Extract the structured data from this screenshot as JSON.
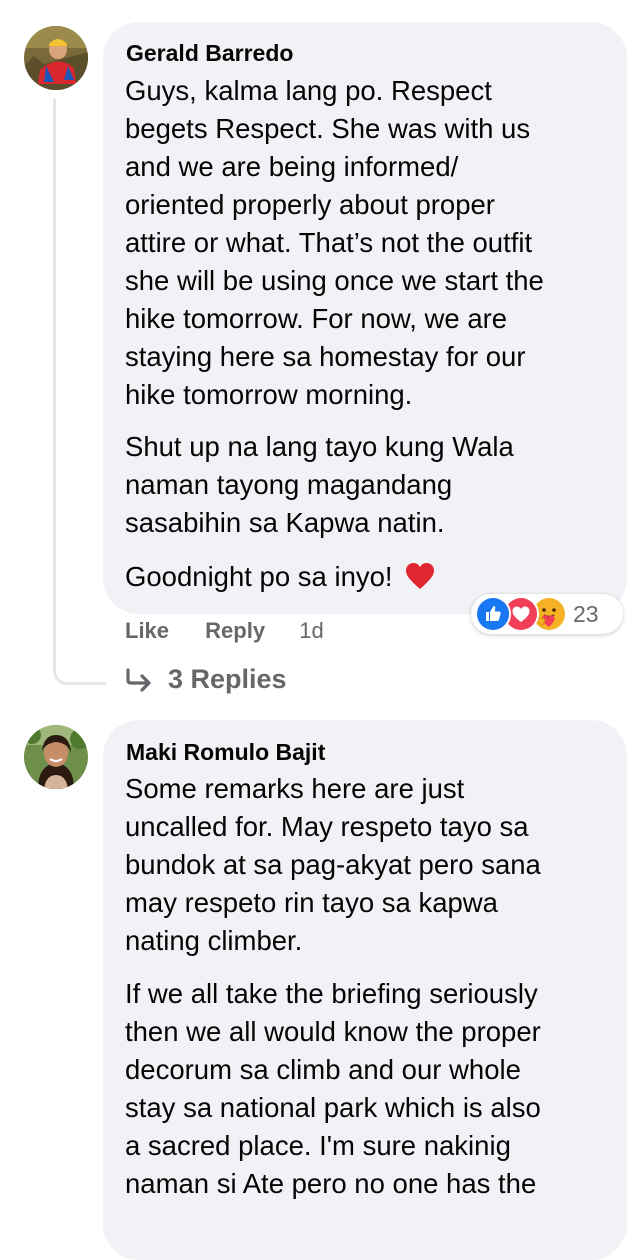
{
  "comments": [
    {
      "author": "Gerald Barredo",
      "paragraphs": [
        [
          "Guys, kalma lang po. Respect",
          "begets Respect. She was with us",
          "and we are being informed/",
          "oriented properly about proper",
          "attire or what. That’s not the outfit",
          "she will be using once we start the",
          "hike tomorrow. For now, we are",
          "staying here sa homestay for our",
          "hike tomorrow morning."
        ],
        [
          "Shut up na lang tayo kung Wala",
          "naman tayong magandang",
          "sasabihin sa Kapwa natin."
        ],
        [
          "Goodnight po sa inyo!"
        ]
      ],
      "actions": {
        "like": "Like",
        "reply": "Reply",
        "time": "1d"
      },
      "reactions": {
        "icons": [
          "like-reaction-icon",
          "love-reaction-icon",
          "care-reaction-icon"
        ],
        "count": "23"
      },
      "replies_label": "3 Replies"
    },
    {
      "author": "Maki Romulo Bajit",
      "paragraphs": [
        [
          "Some remarks here are just",
          "uncalled for. May respeto tayo sa",
          "bundok at sa pag-akyat pero sana",
          "may respeto rin tayo sa kapwa",
          "nating climber."
        ],
        [
          "If we all take the briefing seriously",
          "then we all would know the proper",
          "decorum sa climb and our whole",
          "stay sa national park which is also",
          "a sacred place. I'm sure nakinig",
          "naman si Ate pero no one has the"
        ]
      ]
    }
  ],
  "colors": {
    "bubble": "#f0f2f5",
    "text": "#050505",
    "secondary_text": "#65676b",
    "like_blue": "#1877f2",
    "love_red": "#f33e58",
    "heart_emoji": "#e0262f",
    "thread_line": "#e4e6eb"
  }
}
